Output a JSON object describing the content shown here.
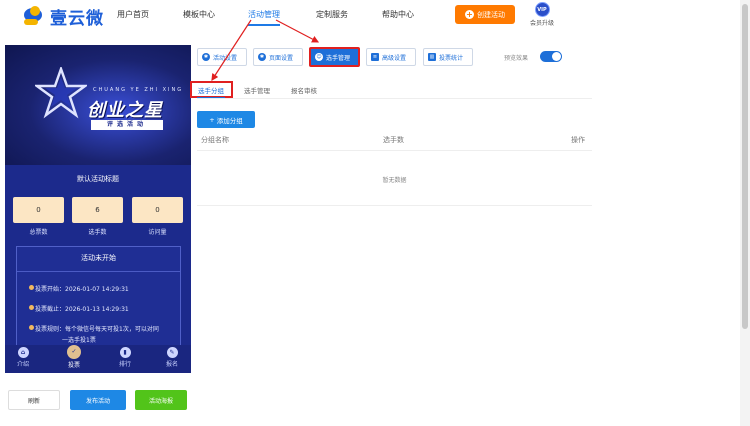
{
  "logo": {
    "text": "壹云微"
  },
  "nav": [
    {
      "label": "用户首页"
    },
    {
      "label": "模板中心"
    },
    {
      "label": "活动管理"
    },
    {
      "label": "定制服务"
    },
    {
      "label": "帮助中心"
    }
  ],
  "header": {
    "create_label": "创建活动",
    "vip_badge": "VIP",
    "vip_label": "会员升级"
  },
  "phone": {
    "header_small": "CHUANG YE ZHI XING",
    "header_big": "创业之星",
    "header_badge": "评选活动",
    "title": "默认活动标题",
    "stats": [
      {
        "value": "0",
        "label": "总票数"
      },
      {
        "value": "6",
        "label": "选手数"
      },
      {
        "value": "0",
        "label": "访问量"
      }
    ],
    "box_title": "活动未开始",
    "info": [
      "投票开始：2026-01-07 14:29:31",
      "投票截止：2026-01-13 14:29:31",
      "投票规则：每个微信号每天可投1次，可以对同",
      "一选手投1票"
    ],
    "tabs": [
      {
        "label": "介绍",
        "icon": "home-icon"
      },
      {
        "label": "投票",
        "icon": "vote-icon"
      },
      {
        "label": "排行",
        "icon": "ranking-icon"
      },
      {
        "label": "报名",
        "icon": "signup-icon"
      }
    ]
  },
  "bottom": {
    "refresh": "刷新",
    "publish": "发布活动",
    "poster": "活动海报"
  },
  "tools": [
    {
      "label": "活动设置",
      "icon": "gear-icon"
    },
    {
      "label": "页面设置",
      "icon": "gear-icon"
    },
    {
      "label": "选手管理",
      "icon": "users-icon"
    },
    {
      "label": "高级设置",
      "icon": "sliders-icon"
    },
    {
      "label": "投票统计",
      "icon": "chart-icon"
    }
  ],
  "preview": {
    "label": "预览效果",
    "enabled": true
  },
  "subtabs": [
    {
      "label": "选手分组"
    },
    {
      "label": "选手管理"
    },
    {
      "label": "报名审核"
    }
  ],
  "add_group": "添加分组",
  "table": {
    "columns": [
      "分组名称",
      "选手数",
      "操作"
    ],
    "empty": "暂无数据"
  },
  "colors": {
    "accent": "#1e6fd8",
    "orange": "#ff7a00",
    "green": "#52c41a",
    "highlight": "#e02020"
  }
}
